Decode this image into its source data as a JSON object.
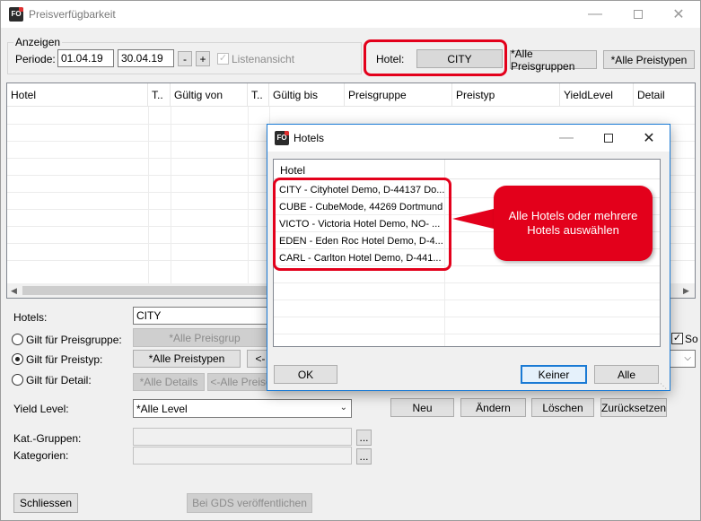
{
  "window": {
    "title": "Preisverfügbarkeit",
    "icon_text": "FO"
  },
  "anzeigen": {
    "group_label": "Anzeigen",
    "periode_label": "Periode:",
    "from": "01.04.19",
    "to": "30.04.19",
    "minus": "-",
    "plus": "+",
    "listenansicht_label": "Listenansicht",
    "listenansicht_check": "✓",
    "hotel_label": "Hotel:",
    "hotel_value": "CITY",
    "alle_preisgruppen": "*Alle Preisgruppen",
    "alle_preistypen": "*Alle Preistypen"
  },
  "grid": {
    "columns": [
      "Hotel",
      "T..",
      "Gültig von",
      "T..",
      "Gültig bis",
      "Preisgruppe",
      "Preistyp",
      "YieldLevel",
      "Detail"
    ]
  },
  "form": {
    "hotels_label": "Hotels:",
    "hotels_value": "CITY",
    "gilt_preisgruppe": "Gilt für Preisgruppe:",
    "gilt_preistyp": "Gilt für Preistyp:",
    "gilt_detail": "Gilt für Detail:",
    "alle_preisgrup_btn": "*Alle Preisgrup",
    "alle_preistypen_btn": "*Alle Preistypen",
    "back_arrow_btn": "<-",
    "alle_details_btn": "*Alle Details",
    "alle_preise_btn": "<-Alle Preise",
    "so_label": "So",
    "so_check": "✓",
    "yield_label": "Yield Level:",
    "yield_value": "*Alle Level",
    "neu": "Neu",
    "aendern": "Ändern",
    "loeschen": "Löschen",
    "zuruecksetzen": "Zurücksetzen",
    "katgruppen_label": "Kat.-Gruppen:",
    "kategorien_label": "Kategorien:",
    "ellipsis": "...",
    "schliessen": "Schliessen",
    "gds": "Bei GDS veröffentlichen"
  },
  "dialog": {
    "title": "Hotels",
    "icon_text": "FO",
    "list_header": "Hotel",
    "items": [
      "CITY - Cityhotel Demo, D-44137 Do...",
      "CUBE - CubeMode, 44269 Dortmund",
      "VICTO - Victoria Hotel Demo, NO- ...",
      "EDEN - Eden Roc Hotel Demo, D-4...",
      "CARL - Carlton Hotel Demo, D-441..."
    ],
    "ok": "OK",
    "keiner": "Keiner",
    "alle": "Alle"
  },
  "callout": {
    "text": "Alle Hotels oder mehrere Hotels auswählen"
  },
  "icons": {
    "minimize": "minimize-icon",
    "maximize": "maximize-icon",
    "close": "close-icon"
  },
  "colors": {
    "highlight": "#e3001b",
    "focus_blue": "#1a7ad4"
  }
}
